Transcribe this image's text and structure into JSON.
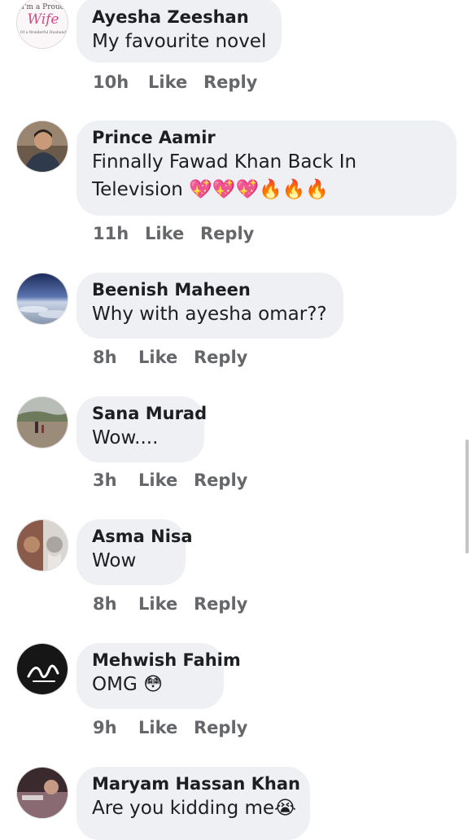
{
  "comments": [
    {
      "author": "Ayesha Zeeshan",
      "text": "My favourite novel",
      "time": "10h",
      "like": "Like",
      "reply": "Reply",
      "avatar_icon": "profile-picture",
      "avatar_text_top": "I'm a Proud",
      "avatar_text_mid": "Wife",
      "avatar_text_bottom": "Of a Wonderful Husband"
    },
    {
      "author": "Prince Aamir",
      "text": "Finnally Fawad Khan Back In",
      "text2": "Television 💖💖💖🔥🔥🔥",
      "time": "11h",
      "like": "Like",
      "reply": "Reply",
      "avatar_icon": "profile-picture"
    },
    {
      "author": "Beenish Maheen",
      "text": "Why with ayesha omar??",
      "time": "8h",
      "like": "Like",
      "reply": "Reply",
      "avatar_icon": "profile-picture"
    },
    {
      "author": "Sana Murad",
      "text": "Wow....",
      "time": "3h",
      "like": "Like",
      "reply": "Reply",
      "avatar_icon": "profile-picture"
    },
    {
      "author": "Asma Nisa",
      "text": "Wow",
      "time": "8h",
      "like": "Like",
      "reply": "Reply",
      "avatar_icon": "profile-picture"
    },
    {
      "author": "Mehwish Fahim",
      "text": "OMG 😳",
      "time": "9h",
      "like": "Like",
      "reply": "Reply",
      "avatar_icon": "profile-picture"
    },
    {
      "author": "Maryam Hassan Khan",
      "text": "Are you kidding me😭",
      "avatar_icon": "profile-picture"
    }
  ],
  "colors": {
    "bubble": "#eef0f3",
    "meta_text": "#65676b",
    "primary_text": "#1c1e21"
  }
}
